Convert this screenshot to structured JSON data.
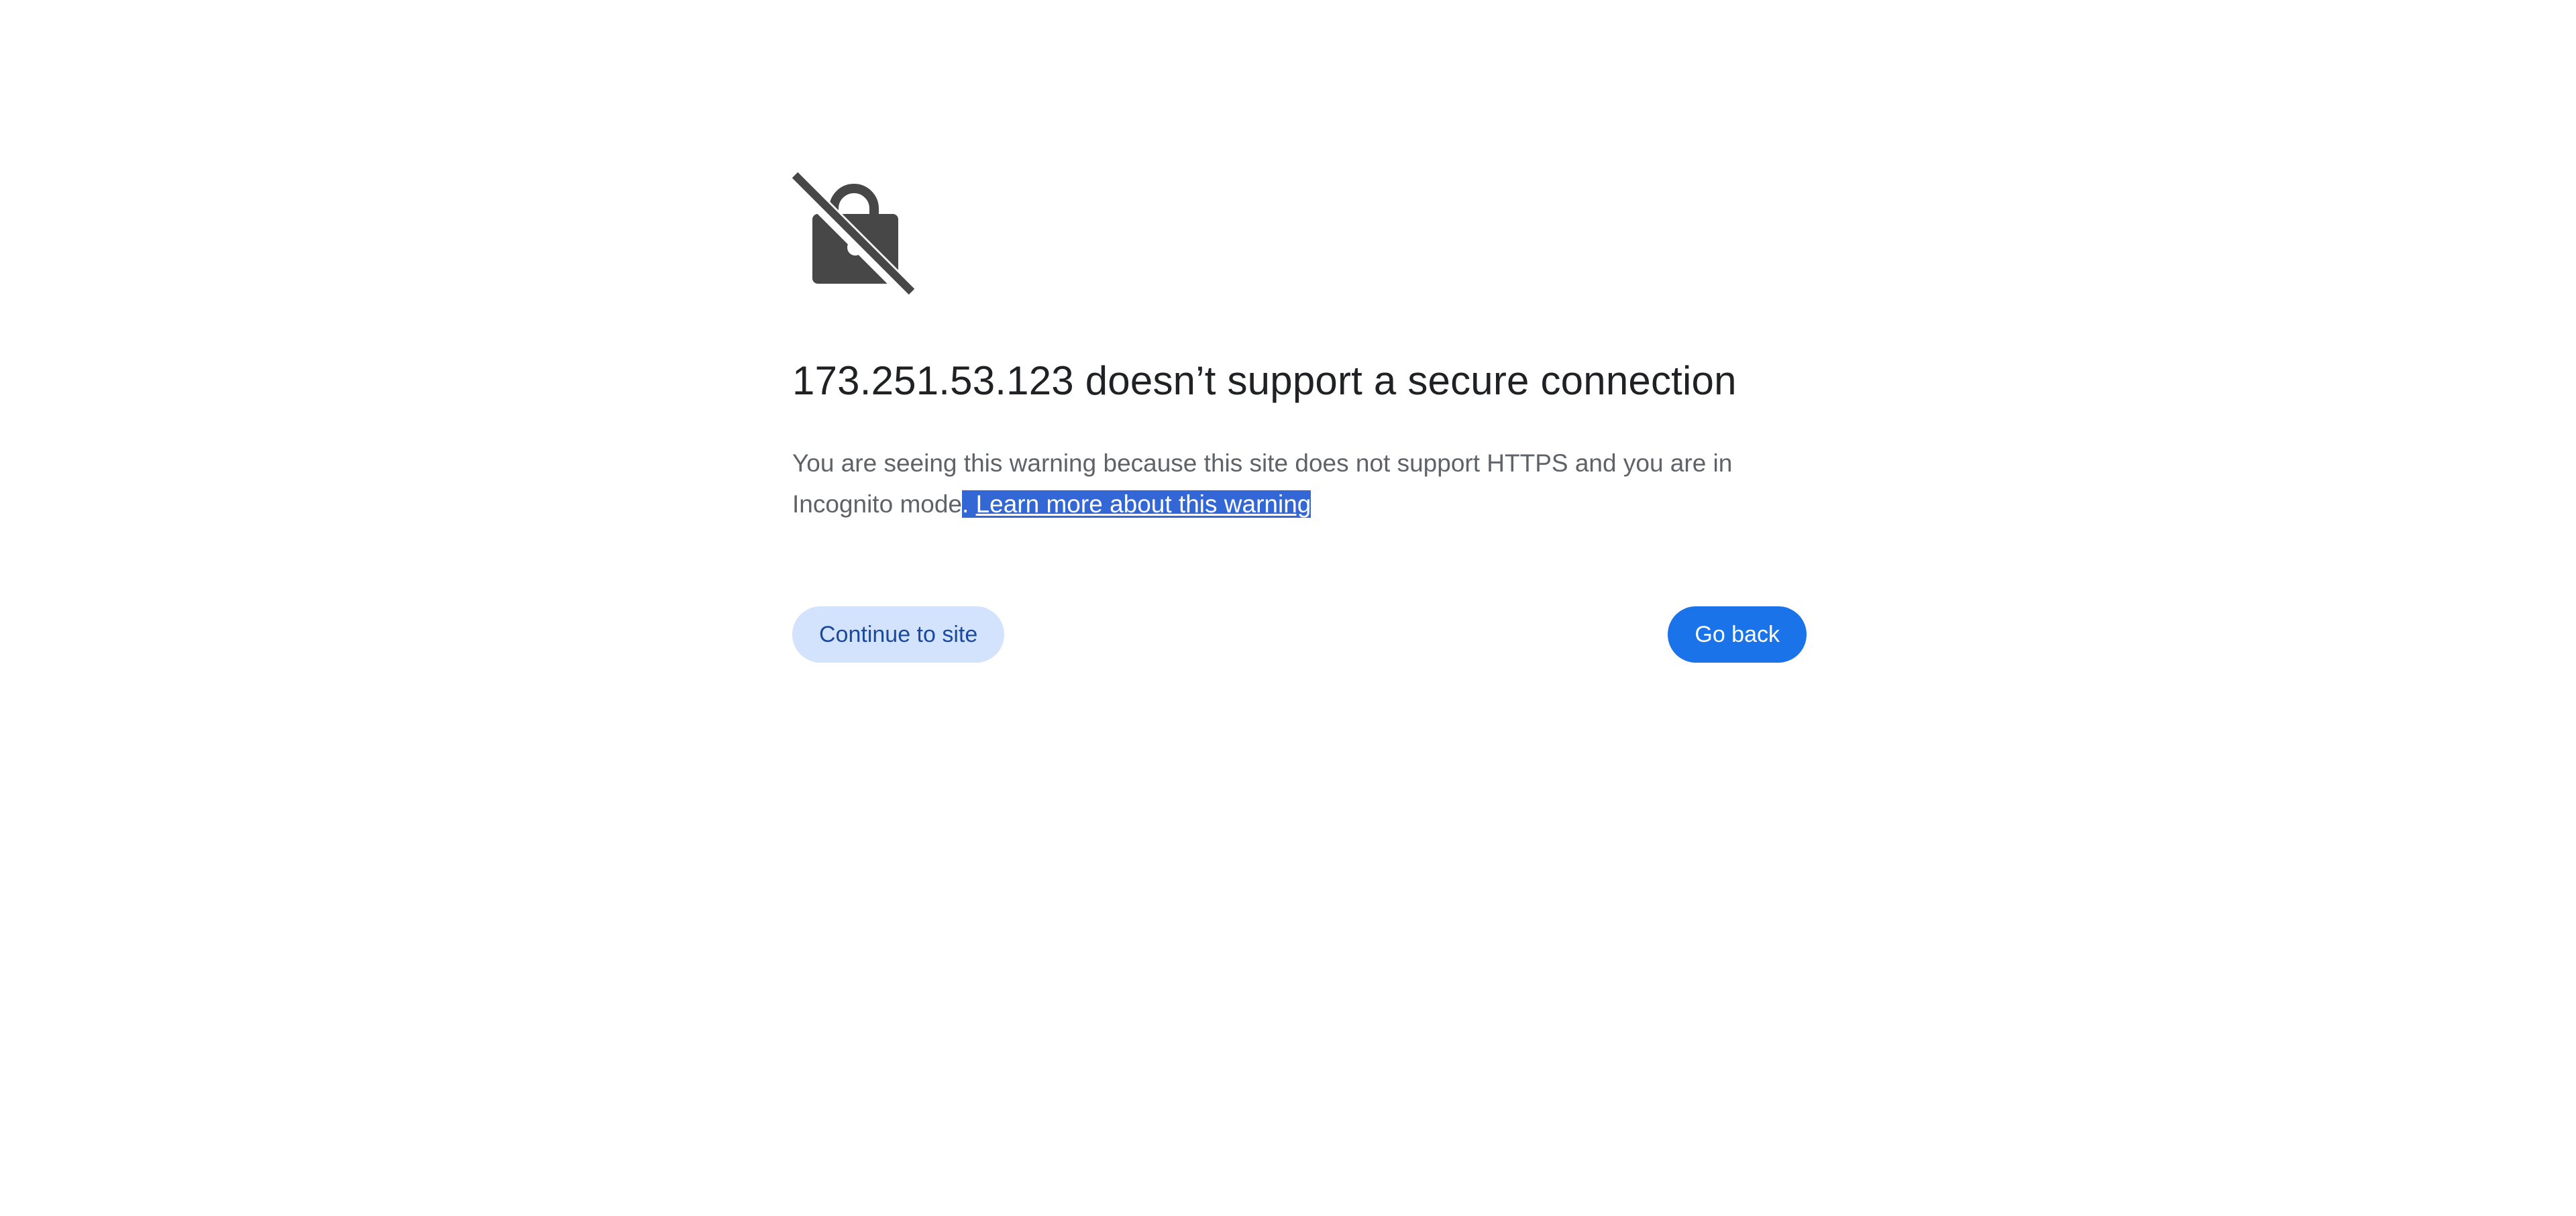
{
  "page": {
    "icon": "insecure-lock-icon",
    "heading": "173.251.53.123 doesn’t support a secure connection",
    "explanation_text": "You are seeing this warning because this site does not support HTTPS and you are in Incognito mode",
    "explanation_separator": ". ",
    "learn_more_link": "Learn more about this warning",
    "continue_button": "Continue to site",
    "go_back_button": "Go back"
  },
  "colors": {
    "background": "#ffffff",
    "heading": "#202124",
    "body_text": "#5f6368",
    "link_highlight": "#3367d6",
    "primary_button": "#1a73e8",
    "secondary_button": "#d3e3fd",
    "icon": "#474747"
  }
}
